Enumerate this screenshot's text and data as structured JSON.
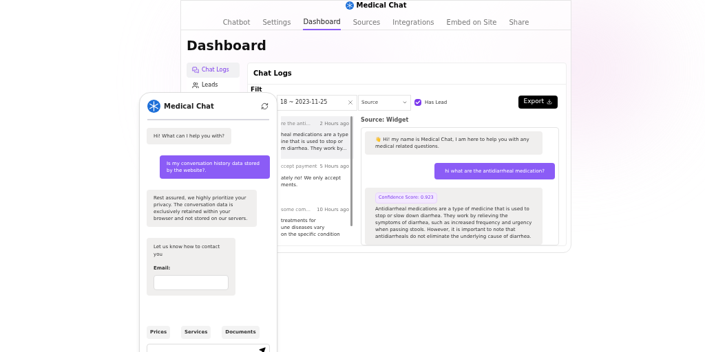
{
  "app_title": "Medical Chat",
  "nav_tabs": [
    {
      "label": "Chatbot",
      "selected": false
    },
    {
      "label": "Settings",
      "selected": false
    },
    {
      "label": "Dashboard",
      "selected": true
    },
    {
      "label": "Sources",
      "selected": false
    },
    {
      "label": "Integrations",
      "selected": false
    },
    {
      "label": "Embed on Site",
      "selected": false
    },
    {
      "label": "Share",
      "selected": false
    }
  ],
  "page_title": "Dashboard",
  "sidebar": {
    "items": [
      {
        "label": "Chat Logs",
        "selected": true
      },
      {
        "label": "Leads",
        "selected": false
      }
    ]
  },
  "panel": {
    "title": "Chat Logs",
    "filter_label": "Filt",
    "date_range": "18 ~ 2023-11-25",
    "source_select": {
      "placeholder": "Source"
    },
    "has_lead": {
      "label": "Has Lead",
      "checked": true
    },
    "export_button": "Export",
    "conversations": [
      {
        "title": "re the anti...",
        "time": "2 Hours ago",
        "preview": [
          "heal medications are a type",
          "ine that is used to stop or",
          "m diarrhea. They work by..."
        ],
        "selected": true
      },
      {
        "title": "ccept payment",
        "time": "5 Hours ago",
        "preview": [
          "ately no! We only accept",
          "ments."
        ],
        "selected": false
      },
      {
        "title": "some com...",
        "time": "10 Hours ago",
        "preview": [
          "treatments for",
          "une diseases vary",
          "on the specific condition"
        ],
        "selected": false
      }
    ],
    "source_label": "Source: Widget",
    "messages": [
      {
        "kind": "bot",
        "text": "👋 Hi! my name is Medical Chat, I am here to help you with any medical related questions."
      },
      {
        "kind": "user",
        "text": "hi what are the antidiarrheal medication?"
      },
      {
        "kind": "bot",
        "confidence": "Confidence Score: 0.923",
        "text": "Antidiarrheal medications are a type of medicine that is used to stop or slow down diarrhea. They work by relieving the symptoms of diarrhea, such as increased frequency and urgency when passing stools. However, it is important to note that antidiarrheals do not eliminate the underlying cause of diarrhea."
      }
    ]
  },
  "widget": {
    "title": "Medical Chat",
    "messages": [
      {
        "kind": "bot",
        "text": "Hi! What can I help you with?"
      },
      {
        "kind": "user",
        "text": "Is my conversation history data stored by the website?."
      },
      {
        "kind": "bot",
        "text": "Rest assured, we highly prioritize your privacy. The conversation data is exclusively retained within your browser and not stored on our servers."
      }
    ],
    "contact": {
      "prompt": "Let us know how to contact you",
      "email_label": "Email:"
    },
    "suggestions": [
      "Prices",
      "Services",
      "Documents"
    ]
  }
}
